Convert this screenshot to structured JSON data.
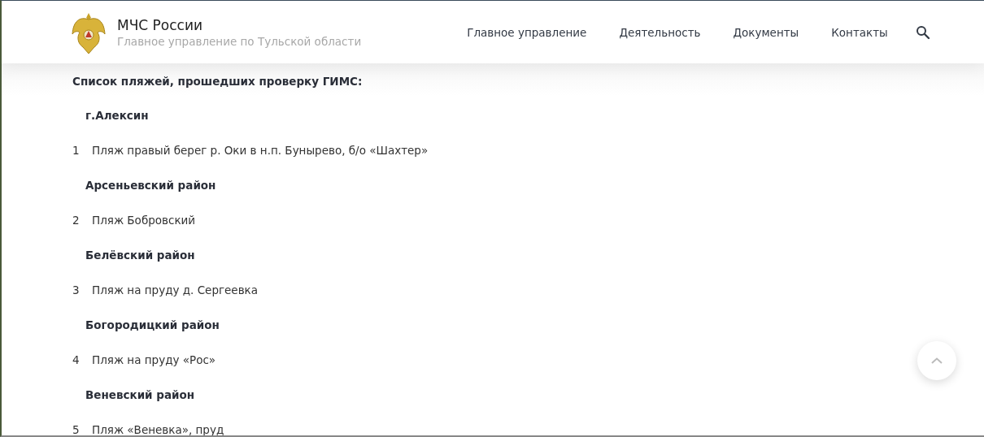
{
  "header": {
    "title": "МЧС России",
    "subtitle": "Главное управление по Тульской области",
    "nav": [
      {
        "label": "Главное управление"
      },
      {
        "label": "Деятельность"
      },
      {
        "label": "Документы"
      },
      {
        "label": "Контакты"
      }
    ]
  },
  "content": {
    "title": "Список пляжей, прошедших проверку ГИМС:",
    "rows": [
      {
        "kind": "heading",
        "text": "г.Алексин"
      },
      {
        "kind": "beach",
        "number": "1",
        "text": "Пляж правый берег р. Оки в н.п. Бунырево, б/о «Шахтер»"
      },
      {
        "kind": "heading",
        "text": "Арсеньевский район"
      },
      {
        "kind": "beach",
        "number": "2",
        "text": "Пляж Бобровский"
      },
      {
        "kind": "heading",
        "text": "Белёвский район"
      },
      {
        "kind": "beach",
        "number": "3",
        "text": "Пляж на пруду д. Сергеевка"
      },
      {
        "kind": "heading",
        "text": "Богородицкий район"
      },
      {
        "kind": "beach",
        "number": "4",
        "text": "Пляж на пруду «Рос»"
      },
      {
        "kind": "heading",
        "text": "Веневский район"
      },
      {
        "kind": "beach",
        "number": "5",
        "text": "Пляж «Веневка», пруд"
      }
    ]
  }
}
